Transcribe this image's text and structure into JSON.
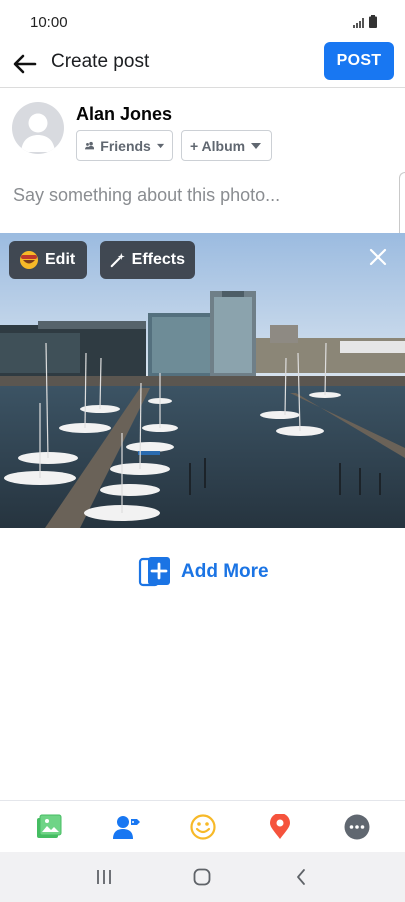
{
  "status_bar": {
    "time": "10:00"
  },
  "app_bar": {
    "title": "Create post",
    "post_label": "POST"
  },
  "composer": {
    "user_name": "Alan Jones",
    "audience_label": "Friends",
    "album_label": "+ Album",
    "caption_placeholder": "Say something about this photo..."
  },
  "photo": {
    "edit_label": "Edit",
    "effects_label": "Effects"
  },
  "add_more": {
    "label": "Add More"
  },
  "toolbar": {
    "items": [
      {
        "icon": "photo-icon",
        "color": "#45bd62"
      },
      {
        "icon": "tag-people-icon",
        "color": "#1877f2"
      },
      {
        "icon": "feeling-icon",
        "color": "#f7b928"
      },
      {
        "icon": "check-in-icon",
        "color": "#f5533d"
      },
      {
        "icon": "more-icon",
        "color": "#606770"
      }
    ]
  },
  "colors": {
    "accent": "#1877f2"
  }
}
